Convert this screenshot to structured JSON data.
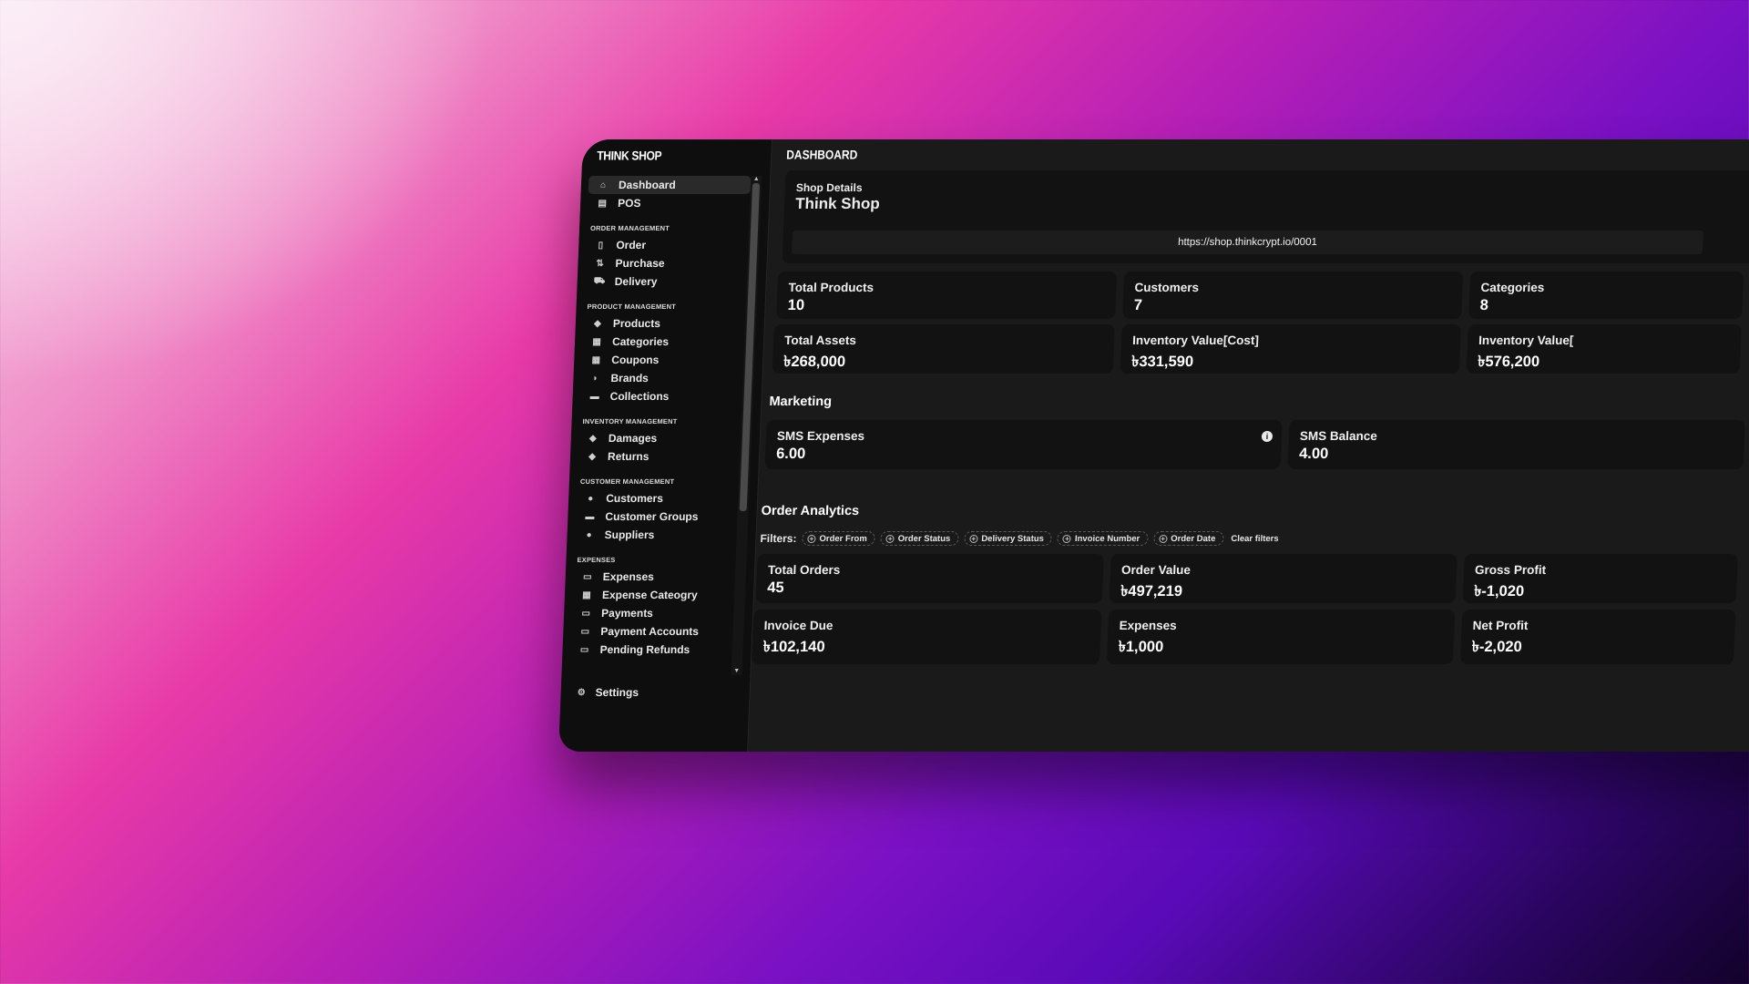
{
  "app": {
    "brand": "THINK SHOP",
    "page_title": "DASHBOARD"
  },
  "sidebar": {
    "top_items": [
      {
        "label": "Dashboard",
        "icon": "home-icon",
        "glyph": "⌂",
        "active": true
      },
      {
        "label": "POS",
        "icon": "pos-icon",
        "glyph": "▤"
      }
    ],
    "sections": [
      {
        "title": "ORDER MANAGEMENT",
        "items": [
          {
            "label": "Order",
            "icon": "order-icon",
            "glyph": "▯"
          },
          {
            "label": "Purchase",
            "icon": "purchase-icon",
            "glyph": "⇅"
          },
          {
            "label": "Delivery",
            "icon": "truck-icon",
            "glyph": "⛟"
          }
        ]
      },
      {
        "title": "PRODUCT MANAGEMENT",
        "items": [
          {
            "label": "Products",
            "icon": "tag-icon",
            "glyph": "◆"
          },
          {
            "label": "Categories",
            "icon": "grid-icon",
            "glyph": "▦"
          },
          {
            "label": "Coupons",
            "icon": "grid-icon",
            "glyph": "▦"
          },
          {
            "label": "Brands",
            "icon": "brush-icon",
            "glyph": "◗"
          },
          {
            "label": "Collections",
            "icon": "folder-icon",
            "glyph": "▬"
          }
        ]
      },
      {
        "title": "INVENTORY MANAGEMENT",
        "items": [
          {
            "label": "Damages",
            "icon": "tag-icon",
            "glyph": "◆"
          },
          {
            "label": "Returns",
            "icon": "tag-icon",
            "glyph": "◆"
          }
        ]
      },
      {
        "title": "CUSTOMER MANAGEMENT",
        "items": [
          {
            "label": "Customers",
            "icon": "user-plus-icon",
            "glyph": "●"
          },
          {
            "label": "Customer Groups",
            "icon": "folder-icon",
            "glyph": "▬"
          },
          {
            "label": "Suppliers",
            "icon": "user-plus-icon",
            "glyph": "●"
          }
        ]
      },
      {
        "title": "EXPENSES",
        "items": [
          {
            "label": "Expenses",
            "icon": "card-icon",
            "glyph": "▭"
          },
          {
            "label": "Expense Cateogry",
            "icon": "grid-icon",
            "glyph": "▦"
          },
          {
            "label": "Payments",
            "icon": "card-icon",
            "glyph": "▭"
          },
          {
            "label": "Payment Accounts",
            "icon": "card-icon",
            "glyph": "▭"
          },
          {
            "label": "Pending Refunds",
            "icon": "card-icon",
            "glyph": "▭"
          }
        ]
      }
    ],
    "settings": {
      "label": "Settings",
      "icon": "gear-icon",
      "glyph": "⚙"
    }
  },
  "shop": {
    "label": "Shop Details",
    "name": "Think Shop",
    "url": "https://shop.thinkcrypt.io/0001"
  },
  "stats": {
    "total_products": {
      "label": "Total Products",
      "value": "10"
    },
    "customers": {
      "label": "Customers",
      "value": "7"
    },
    "categories": {
      "label": "Categories",
      "value": "8"
    },
    "total_assets": {
      "label": "Total Assets",
      "value": "৳268,000"
    },
    "inventory_cost": {
      "label": "Inventory Value[Cost]",
      "value": "৳331,590"
    },
    "inventory_value": {
      "label": "Inventory Value[",
      "value": "৳576,200"
    }
  },
  "marketing": {
    "title": "Marketing",
    "sms_expenses": {
      "label": "SMS Expenses",
      "value": "6.00"
    },
    "sms_balance": {
      "label": "SMS Balance",
      "value": "4.00"
    }
  },
  "order_analytics": {
    "title": "Order Analytics",
    "filters_label": "Filters:",
    "filters": [
      "Order From",
      "Order Status",
      "Delivery Status",
      "Invoice Number",
      "Order Date"
    ],
    "clear_label": "Clear filters",
    "total_orders": {
      "label": "Total Orders",
      "value": "45"
    },
    "order_value": {
      "label": "Order Value",
      "value": "৳497,219"
    },
    "gross_profit": {
      "label": "Gross Profit",
      "value": "৳-1,020"
    },
    "invoice_due": {
      "label": "Invoice Due",
      "value": "৳102,140"
    },
    "expenses": {
      "label": "Expenses",
      "value": "৳1,000"
    },
    "net_profit": {
      "label": "Net Profit",
      "value": "৳-2,020"
    }
  },
  "colors": {
    "window_bg": "#1a1a1a",
    "sidebar_bg": "#0e0e0e",
    "card_bg": "#121212",
    "text": "#ececec"
  }
}
